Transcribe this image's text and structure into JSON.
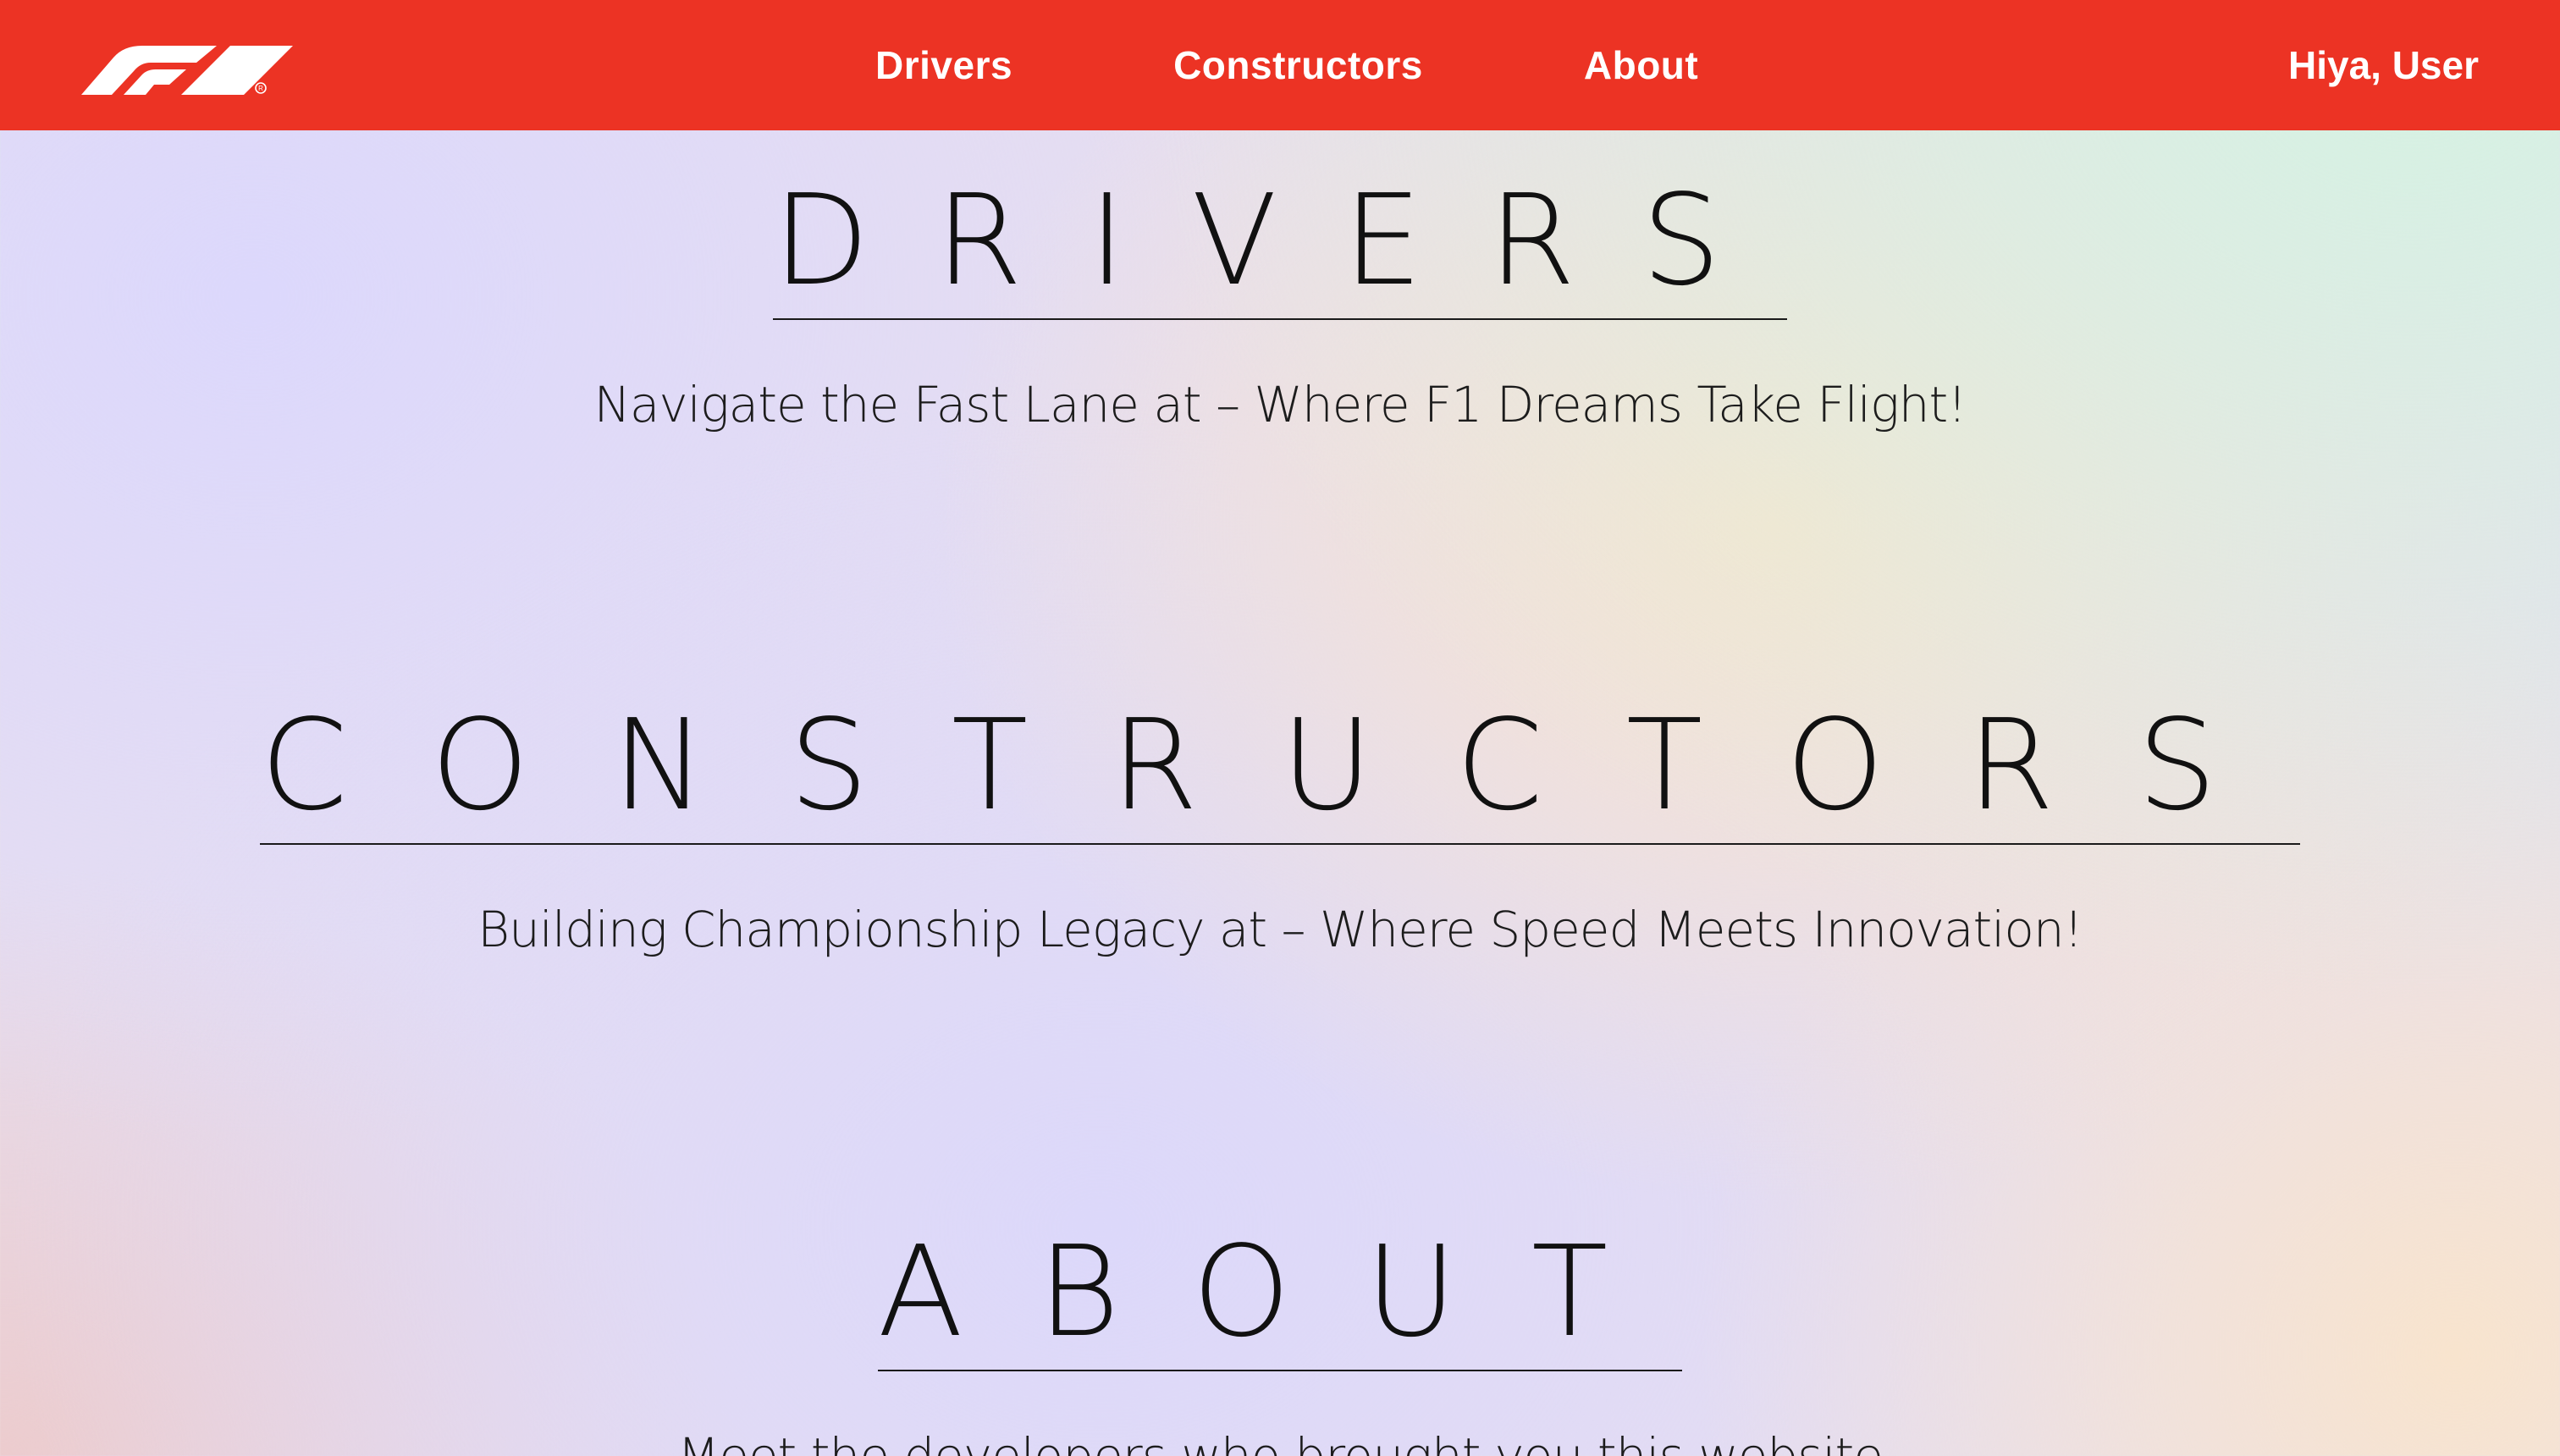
{
  "nav": {
    "logo_alt": "F1",
    "links": [
      "Drivers",
      "Constructors",
      "About"
    ],
    "greeting": "Hiya, User"
  },
  "sections": {
    "drivers": {
      "heading": "DRIVERS",
      "tagline": "Navigate the Fast Lane at – Where F1 Dreams Take Flight!"
    },
    "constructors": {
      "heading": "CONSTRUCTORS",
      "tagline": "Building Championship Legacy at – Where Speed Meets Innovation!"
    },
    "about": {
      "heading": "ABOUT",
      "tagline": "Meet the developers who brought you this website"
    }
  },
  "colors": {
    "nav_background": "#ec3324",
    "nav_text": "#ffffff",
    "heading_text": "#111111"
  },
  "icons": {
    "logo": "f1-logo-icon"
  }
}
